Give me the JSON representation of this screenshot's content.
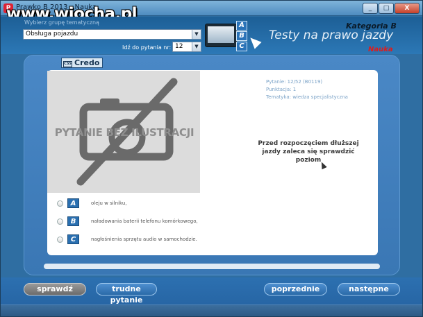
{
  "window": {
    "title": "Prawko B 2013 - Nauka",
    "watermark": "www.wiocha.pl",
    "minimize": "_",
    "maximize": "□",
    "close": "X"
  },
  "header": {
    "category_label": "Wybierz grupę tematyczną",
    "category_value": "Obsługa pojazdu",
    "goto_label": "Idź do pytania nr:",
    "goto_value": "12",
    "abc": [
      "A",
      "B",
      "C"
    ],
    "kategoria": "Kategoria B",
    "app_title": "Testy na prawo jazdy",
    "mode": "Nauka"
  },
  "panel": {
    "logo_badge": "CSS",
    "logo_text": "Credo",
    "no_image_text": "PYTANIE BEZ ILUSTRACJI",
    "meta": {
      "pytanie": "Pytanie: 12/52 (B0119)",
      "punktacja": "Punktacja: 1",
      "tematyka": "Tematyka: wiedza specjalistyczna"
    },
    "question": "Przed rozpoczęciem dłuższej jazdy zaleca się sprawdzić poziom",
    "answers": [
      {
        "letter": "A",
        "text": "oleju w silniku,"
      },
      {
        "letter": "B",
        "text": "naładowania baterii telefonu komórkowego,"
      },
      {
        "letter": "C",
        "text": "nagłośnienia sprzętu audio w samochodzie."
      }
    ]
  },
  "buttons": {
    "check": "sprawdź",
    "hard": "trudne pytanie",
    "prev": "poprzednie",
    "next": "następne"
  },
  "colors": {
    "accent": "#2a6fb0",
    "mode": "#e01b1b"
  }
}
